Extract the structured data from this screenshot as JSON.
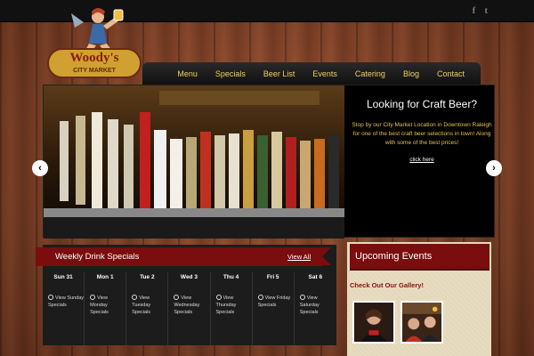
{
  "social": {
    "facebook": "f",
    "twitter": "t"
  },
  "logo": {
    "text_line1": "Woody's",
    "text_line2": "CITY MARKET"
  },
  "nav": [
    "Menu",
    "Specials",
    "Beer List",
    "Events",
    "Catering",
    "Blog",
    "Contact"
  ],
  "slider": {
    "title": "Looking for Craft Beer?",
    "body": "Stop by our City Market Location in Downtown Raleigh for one of the best craft beer selections in town! Along with some of the best prices!",
    "link": "click here",
    "prev": "‹",
    "next": "›"
  },
  "drinks": {
    "title": "Weekly Drink Specials",
    "view_all": "View All",
    "days": [
      {
        "name": "Sun 31",
        "link": "View Sunday Specials"
      },
      {
        "name": "Mon 1",
        "link": "View Monday Specials"
      },
      {
        "name": "Tue 2",
        "link": "View Tuesday Specials"
      },
      {
        "name": "Wed 3",
        "link": "View Wednesday Specials"
      },
      {
        "name": "Thu 4",
        "link": "View Thursday Specials"
      },
      {
        "name": "Fri 5",
        "link": "View Friday Specials"
      },
      {
        "name": "Sat 6",
        "link": "View Saturday Specials"
      }
    ]
  },
  "events": {
    "title": "Upcoming Events",
    "gallery": "Check Out Our Gallery!"
  },
  "colors": {
    "accent": "#7a0d0d",
    "nav_text": "#f0d060",
    "slide_body": "#e6c24a"
  }
}
